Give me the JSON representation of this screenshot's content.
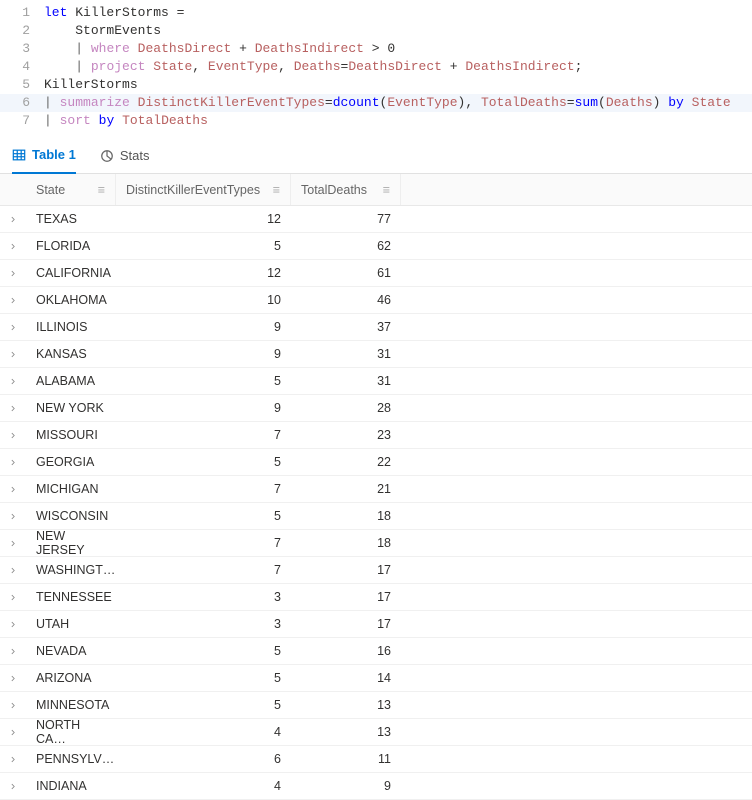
{
  "editor_lines": [
    {
      "n": 1,
      "hl": false,
      "tokens": [
        {
          "t": "let",
          "c": "kw"
        },
        {
          "t": " ",
          "c": ""
        },
        {
          "t": "KillerStorms",
          "c": ""
        },
        {
          "t": " = ",
          "c": ""
        }
      ]
    },
    {
      "n": 2,
      "hl": false,
      "tokens": [
        {
          "t": "    ",
          "c": ""
        },
        {
          "t": "StormEvents",
          "c": ""
        }
      ]
    },
    {
      "n": 3,
      "hl": false,
      "tokens": [
        {
          "t": "    ",
          "c": ""
        },
        {
          "t": "|",
          "c": "pipe"
        },
        {
          "t": " ",
          "c": ""
        },
        {
          "t": "where",
          "c": "op"
        },
        {
          "t": " ",
          "c": ""
        },
        {
          "t": "DeathsDirect",
          "c": "col"
        },
        {
          "t": " + ",
          "c": ""
        },
        {
          "t": "DeathsIndirect",
          "c": "col"
        },
        {
          "t": " > ",
          "c": ""
        },
        {
          "t": "0",
          "c": ""
        }
      ]
    },
    {
      "n": 4,
      "hl": false,
      "tokens": [
        {
          "t": "    ",
          "c": ""
        },
        {
          "t": "|",
          "c": "pipe"
        },
        {
          "t": " ",
          "c": ""
        },
        {
          "t": "project",
          "c": "op"
        },
        {
          "t": " ",
          "c": ""
        },
        {
          "t": "State",
          "c": "col"
        },
        {
          "t": ", ",
          "c": ""
        },
        {
          "t": "EventType",
          "c": "col"
        },
        {
          "t": ", ",
          "c": ""
        },
        {
          "t": "Deaths",
          "c": "col"
        },
        {
          "t": "=",
          "c": ""
        },
        {
          "t": "DeathsDirect",
          "c": "col"
        },
        {
          "t": " + ",
          "c": ""
        },
        {
          "t": "DeathsIndirect",
          "c": "col"
        },
        {
          "t": ";",
          "c": ""
        }
      ]
    },
    {
      "n": 5,
      "hl": false,
      "tokens": [
        {
          "t": "KillerStorms",
          "c": ""
        }
      ]
    },
    {
      "n": 6,
      "hl": true,
      "tokens": [
        {
          "t": "|",
          "c": "pipe"
        },
        {
          "t": " ",
          "c": ""
        },
        {
          "t": "summarize",
          "c": "op"
        },
        {
          "t": " ",
          "c": ""
        },
        {
          "t": "DistinctKillerEventTypes",
          "c": "col"
        },
        {
          "t": "=",
          "c": ""
        },
        {
          "t": "dcount",
          "c": "fn"
        },
        {
          "t": "(",
          "c": ""
        },
        {
          "t": "EventType",
          "c": "col"
        },
        {
          "t": "), ",
          "c": ""
        },
        {
          "t": "TotalDeaths",
          "c": "col"
        },
        {
          "t": "=",
          "c": ""
        },
        {
          "t": "sum",
          "c": "fn"
        },
        {
          "t": "(",
          "c": ""
        },
        {
          "t": "Deaths",
          "c": "col"
        },
        {
          "t": ") ",
          "c": ""
        },
        {
          "t": "by",
          "c": "kw"
        },
        {
          "t": " ",
          "c": ""
        },
        {
          "t": "State",
          "c": "col"
        }
      ]
    },
    {
      "n": 7,
      "hl": false,
      "tokens": [
        {
          "t": "|",
          "c": "pipe"
        },
        {
          "t": " ",
          "c": ""
        },
        {
          "t": "sort",
          "c": "op"
        },
        {
          "t": " ",
          "c": ""
        },
        {
          "t": "by",
          "c": "kw"
        },
        {
          "t": " ",
          "c": ""
        },
        {
          "t": "TotalDeaths",
          "c": "col"
        }
      ]
    }
  ],
  "tabs": {
    "table_label": "Table 1",
    "stats_label": "Stats"
  },
  "columns": {
    "state": "State",
    "dket": "DistinctKillerEventTypes",
    "td": "TotalDeaths",
    "menu_glyph": "≡"
  },
  "rows": [
    {
      "state": "TEXAS",
      "dket": 12,
      "td": 77
    },
    {
      "state": "FLORIDA",
      "dket": 5,
      "td": 62
    },
    {
      "state": "CALIFORNIA",
      "dket": 12,
      "td": 61
    },
    {
      "state": "OKLAHOMA",
      "dket": 10,
      "td": 46
    },
    {
      "state": "ILLINOIS",
      "dket": 9,
      "td": 37
    },
    {
      "state": "KANSAS",
      "dket": 9,
      "td": 31
    },
    {
      "state": "ALABAMA",
      "dket": 5,
      "td": 31
    },
    {
      "state": "NEW YORK",
      "dket": 9,
      "td": 28
    },
    {
      "state": "MISSOURI",
      "dket": 7,
      "td": 23
    },
    {
      "state": "GEORGIA",
      "dket": 5,
      "td": 22
    },
    {
      "state": "MICHIGAN",
      "dket": 7,
      "td": 21
    },
    {
      "state": "WISCONSIN",
      "dket": 5,
      "td": 18
    },
    {
      "state": "NEW JERSEY",
      "dket": 7,
      "td": 18
    },
    {
      "state": "WASHINGT…",
      "dket": 7,
      "td": 17
    },
    {
      "state": "TENNESSEE",
      "dket": 3,
      "td": 17
    },
    {
      "state": "UTAH",
      "dket": 3,
      "td": 17
    },
    {
      "state": "NEVADA",
      "dket": 5,
      "td": 16
    },
    {
      "state": "ARIZONA",
      "dket": 5,
      "td": 14
    },
    {
      "state": "MINNESOTA",
      "dket": 5,
      "td": 13
    },
    {
      "state": "NORTH CA…",
      "dket": 4,
      "td": 13
    },
    {
      "state": "PENNSYLV…",
      "dket": 6,
      "td": 11
    },
    {
      "state": "INDIANA",
      "dket": 4,
      "td": 9
    }
  ]
}
